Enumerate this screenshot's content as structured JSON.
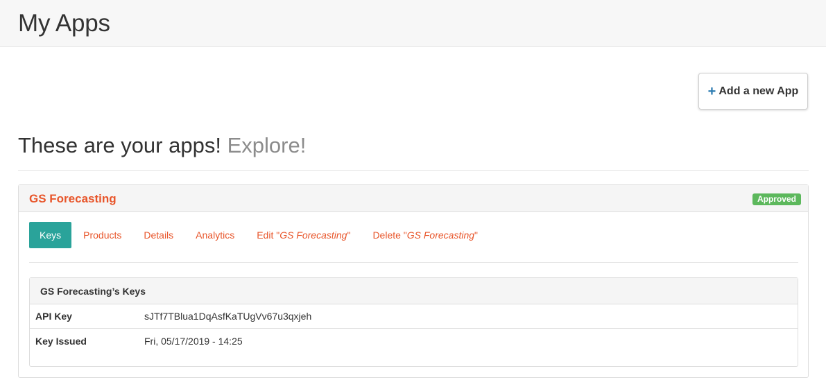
{
  "header": {
    "title": "My Apps"
  },
  "actions": {
    "add_label": "Add a new App"
  },
  "headline": {
    "main": "These are your apps!",
    "muted": "Explore!"
  },
  "app": {
    "name": "GS Forecasting",
    "status": "Approved",
    "tabs": {
      "keys": "Keys",
      "products": "Products",
      "details": "Details",
      "analytics": "Analytics",
      "edit_prefix": "Edit \"",
      "edit_app": "GS Forecasting",
      "edit_suffix": "\"",
      "delete_prefix": "Delete \"",
      "delete_app": "GS Forecasting",
      "delete_suffix": "\""
    },
    "keys_panel": {
      "title": "GS Forecasting’s Keys",
      "rows": [
        {
          "label": "API Key",
          "value": "sJTf7TBlua1DqAsfKaTUgVv67u3qxjeh"
        },
        {
          "label": "Key Issued",
          "value": "Fri, 05/17/2019 - 14:25"
        }
      ]
    }
  },
  "colors": {
    "accent": "#e8552a",
    "active_tab": "#2aa39a",
    "approved": "#5cb85c",
    "plus_icon": "#2a7ab0"
  }
}
